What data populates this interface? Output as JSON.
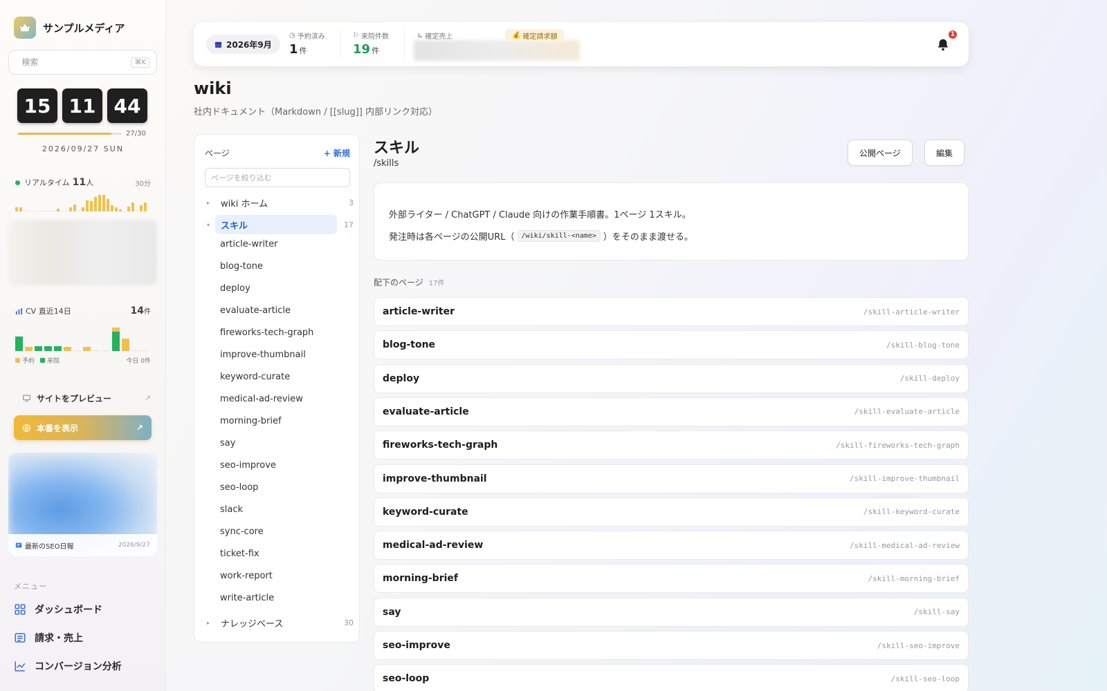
{
  "brand": {
    "name": "サンプルメディア",
    "logo_icon": "crown-icon"
  },
  "search": {
    "placeholder": "検索",
    "shortcut": "⌘K"
  },
  "clock": {
    "hours": "15",
    "minutes": "11",
    "seconds": "44",
    "day_count": "27/30",
    "day_progress": 0.9,
    "date": "2026/09/27 SUN"
  },
  "realtime": {
    "label": "リアルタイム",
    "count": "11",
    "unit": "人",
    "window": "30分"
  },
  "cv": {
    "label": "CV 直近14日",
    "count": "14",
    "unit": "件",
    "legend_booked": "予約",
    "legend_visit": "来院",
    "today": "今日 0件",
    "colors": {
      "booked": "#f1c04c",
      "visit": "#22b35e"
    }
  },
  "preview": {
    "site_preview": "サイトをプレビュー",
    "production": "本番を表示"
  },
  "seo_card": {
    "title": "最新のSEO日報",
    "date": "2026/9/27"
  },
  "menu": {
    "title": "メニュー",
    "items": [
      {
        "label": "ダッシュボード",
        "icon": "grid-icon"
      },
      {
        "label": "請求・売上",
        "icon": "invoice-icon"
      },
      {
        "label": "コンバージョン分析",
        "icon": "chart-line-icon"
      }
    ]
  },
  "topbar": {
    "month": "2026年9月",
    "reserved_label": "予約済み",
    "reserved_value": "1",
    "reserved_unit": "件",
    "visits_label": "来院件数",
    "visits_value": "19",
    "visits_unit": "件",
    "sales_label": "確定売上",
    "billing_label": "確定請求額",
    "notification_count": "1"
  },
  "page": {
    "title": "wiki",
    "subtitle": "社内ドキュメント（Markdown / [[slug]] 内部リンク対応）"
  },
  "tree": {
    "header": "ページ",
    "new_label": "+ 新規",
    "filter_placeholder": "ページを絞り込む",
    "home": {
      "label": "wiki ホーム",
      "count": "3"
    },
    "skills": {
      "label": "スキル",
      "count": "17"
    },
    "children": [
      "article-writer",
      "blog-tone",
      "deploy",
      "evaluate-article",
      "fireworks-tech-graph",
      "improve-thumbnail",
      "keyword-curate",
      "medical-ad-review",
      "morning-brief",
      "say",
      "seo-improve",
      "seo-loop",
      "slack",
      "sync-core",
      "ticket-fix",
      "work-report",
      "write-article"
    ],
    "knowledge": {
      "label": "ナレッジベース",
      "count": "30"
    }
  },
  "detail": {
    "title": "スキル",
    "slug": "/skills",
    "public_button": "公開ページ",
    "edit_button": "編集",
    "desc_line1": "外部ライター / ChatGPT / Claude 向けの作業手順書。1ページ 1スキル。",
    "desc_line2_pre": "発注時は各ページの公開URL（",
    "desc_line2_code": "/wiki/skill-<name>",
    "desc_line2_post": "）をそのまま渡せる。",
    "children_label": "配下のページ",
    "children_count": "17件",
    "children": [
      {
        "name": "article-writer",
        "path": "/skill-article-writer"
      },
      {
        "name": "blog-tone",
        "path": "/skill-blog-tone"
      },
      {
        "name": "deploy",
        "path": "/skill-deploy"
      },
      {
        "name": "evaluate-article",
        "path": "/skill-evaluate-article"
      },
      {
        "name": "fireworks-tech-graph",
        "path": "/skill-fireworks-tech-graph"
      },
      {
        "name": "improve-thumbnail",
        "path": "/skill-improve-thumbnail"
      },
      {
        "name": "keyword-curate",
        "path": "/skill-keyword-curate"
      },
      {
        "name": "medical-ad-review",
        "path": "/skill-medical-ad-review"
      },
      {
        "name": "morning-brief",
        "path": "/skill-morning-brief"
      },
      {
        "name": "say",
        "path": "/skill-say"
      },
      {
        "name": "seo-improve",
        "path": "/skill-seo-improve"
      },
      {
        "name": "seo-loop",
        "path": "/skill-seo-loop"
      }
    ]
  }
}
